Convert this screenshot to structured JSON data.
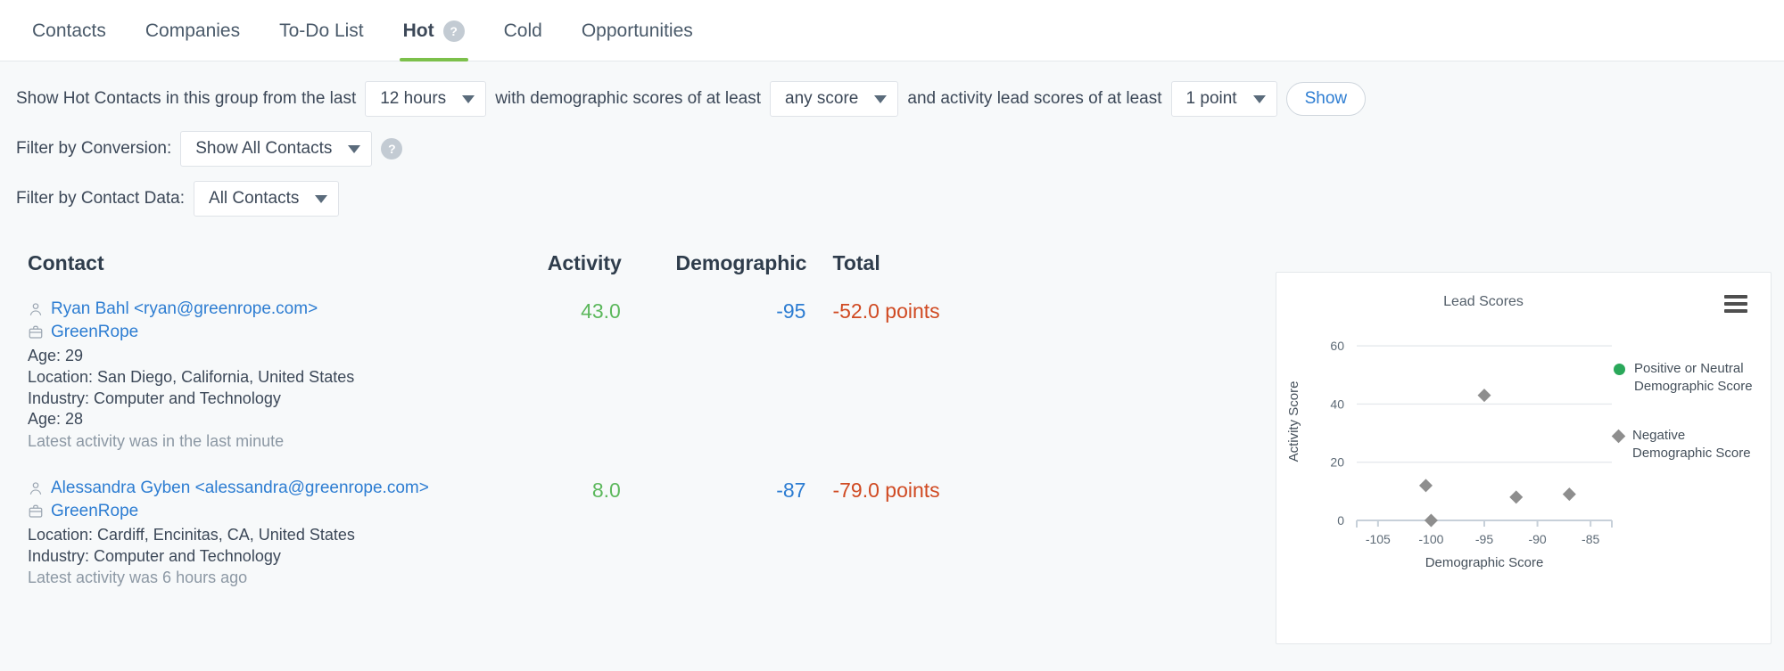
{
  "nav": {
    "tabs": [
      {
        "label": "Contacts",
        "active": false,
        "help": false
      },
      {
        "label": "Companies",
        "active": false,
        "help": false
      },
      {
        "label": "To-Do List",
        "active": false,
        "help": false
      },
      {
        "label": "Hot",
        "active": true,
        "help": true,
        "help_glyph": "?"
      },
      {
        "label": "Cold",
        "active": false,
        "help": false
      },
      {
        "label": "Opportunities",
        "active": false,
        "help": false
      }
    ]
  },
  "filters": {
    "row1": {
      "prefix": "Show Hot Contacts in this group from the last",
      "timeframe_value": "12 hours",
      "mid": "with demographic scores of at least",
      "demographic_value": "any score",
      "suffix": "and activity lead scores of at least",
      "activity_value": "1 point",
      "show_label": "Show"
    },
    "row2": {
      "label": "Filter by Conversion:",
      "value": "Show All Contacts",
      "help_glyph": "?"
    },
    "row3": {
      "label": "Filter by Contact Data:",
      "value": "All Contacts"
    }
  },
  "table": {
    "headers": {
      "contact": "Contact",
      "activity": "Activity",
      "demographic": "Demographic",
      "total": "Total"
    },
    "rows": [
      {
        "name": "Ryan Bahl <ryan@greenrope.com>",
        "company": "GreenRope",
        "meta": "Age: 29\nLocation: San Diego, California, United States\nIndustry: Computer and Technology\nAge: 28",
        "latest": "Latest activity was in the last minute",
        "activity": "43.0",
        "demographic": "-95",
        "total": "-52.0 points"
      },
      {
        "name": "Alessandra Gyben <alessandra@greenrope.com>",
        "company": "GreenRope",
        "meta": "Location: Cardiff, Encinitas, CA, United States\nIndustry: Computer and Technology",
        "latest": "Latest activity was 6 hours ago",
        "activity": "8.0",
        "demographic": "-87",
        "total": "-79.0 points"
      }
    ]
  },
  "chart_data": {
    "type": "scatter",
    "title": "Lead Scores",
    "xlabel": "Demographic Score",
    "ylabel": "Activity Score",
    "xlim": [
      -107,
      -83
    ],
    "ylim": [
      0,
      68
    ],
    "xticks": [
      "-105",
      "-100",
      "-95",
      "-90",
      "-85"
    ],
    "xtick_values": [
      -105,
      -100,
      -95,
      -90,
      -85
    ],
    "yticks": [
      "0",
      "20",
      "40",
      "60"
    ],
    "ytick_values": [
      0,
      20,
      40,
      60
    ],
    "grid": true,
    "legend_position": "right",
    "series": [
      {
        "name": "Positive or Neutral Demographic Score",
        "marker": "circle",
        "color": "#2aa85a",
        "points": []
      },
      {
        "name": "Negative Demographic Score",
        "marker": "diamond",
        "color": "#8e8e8e",
        "points": [
          {
            "x": -95.0,
            "y": 43.0
          },
          {
            "x": -100.5,
            "y": 12.0
          },
          {
            "x": -92.0,
            "y": 8.0
          },
          {
            "x": -87.0,
            "y": 9.0
          },
          {
            "x": -100.0,
            "y": 0.0
          }
        ]
      }
    ]
  },
  "chart_menu": {
    "name": "menu"
  },
  "colors": {
    "accent_green": "#7cc04b",
    "link_blue": "#2d7dd2",
    "activity_green": "#5cb85c",
    "total_red": "#d04a22",
    "marker_gray": "#8e8e8e",
    "legend_green": "#2aa85a"
  }
}
